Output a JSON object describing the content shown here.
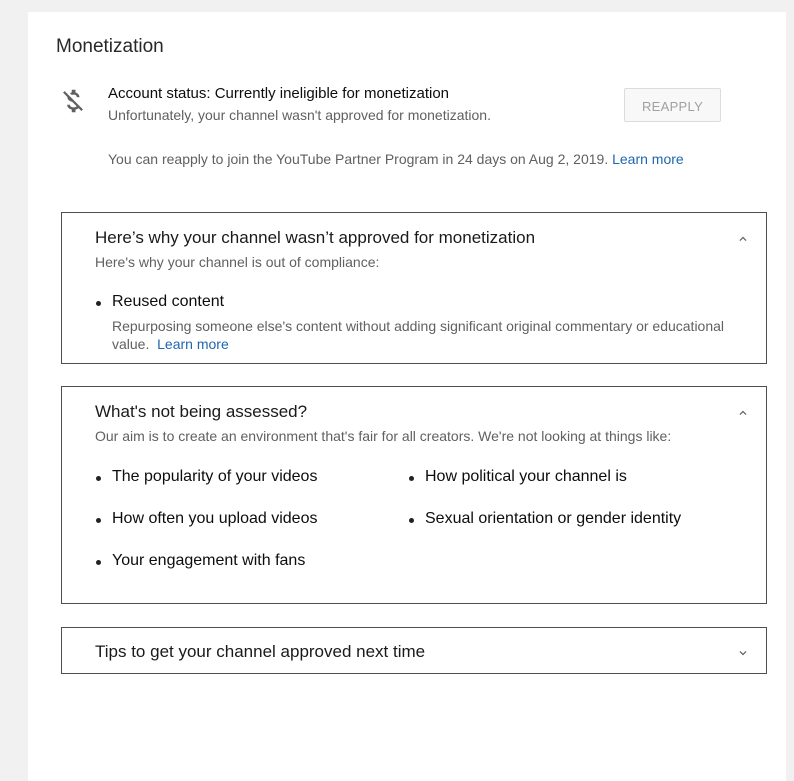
{
  "page": {
    "title": "Monetization"
  },
  "status": {
    "icon": "money-off-icon",
    "title": "Account status: Currently ineligible for monetization",
    "subtitle": "Unfortunately, your channel wasn't approved for monetization.",
    "reapply_label": "REAPPLY",
    "reapply_note": "You can reapply to join the YouTube Partner Program in 24 days on Aug 2, 2019.",
    "learn_more": "Learn more"
  },
  "panels": {
    "why": {
      "title": "Here’s why your channel wasn’t approved for monetization",
      "subtitle": "Here's why your channel is out of compliance:",
      "items": [
        {
          "label": "Reused content",
          "description": "Repurposing someone else's content without adding significant original commentary or educational value.",
          "link": "Learn more"
        }
      ],
      "expanded": true
    },
    "not_assessed": {
      "title": "What's not being assessed?",
      "subtitle": "Our aim is to create an environment that's fair for all creators. We're not looking at things like:",
      "items_left": [
        "The popularity of your videos",
        "How often you upload videos",
        "Your engagement with fans"
      ],
      "items_right": [
        "How political your channel is",
        "Sexual orientation or gender identity"
      ],
      "expanded": true
    },
    "tips": {
      "title": "Tips to get your channel approved next time",
      "expanded": false
    }
  },
  "colors": {
    "link": "#1f66b0",
    "border": "#4f4f4f",
    "muted": "#606060"
  }
}
